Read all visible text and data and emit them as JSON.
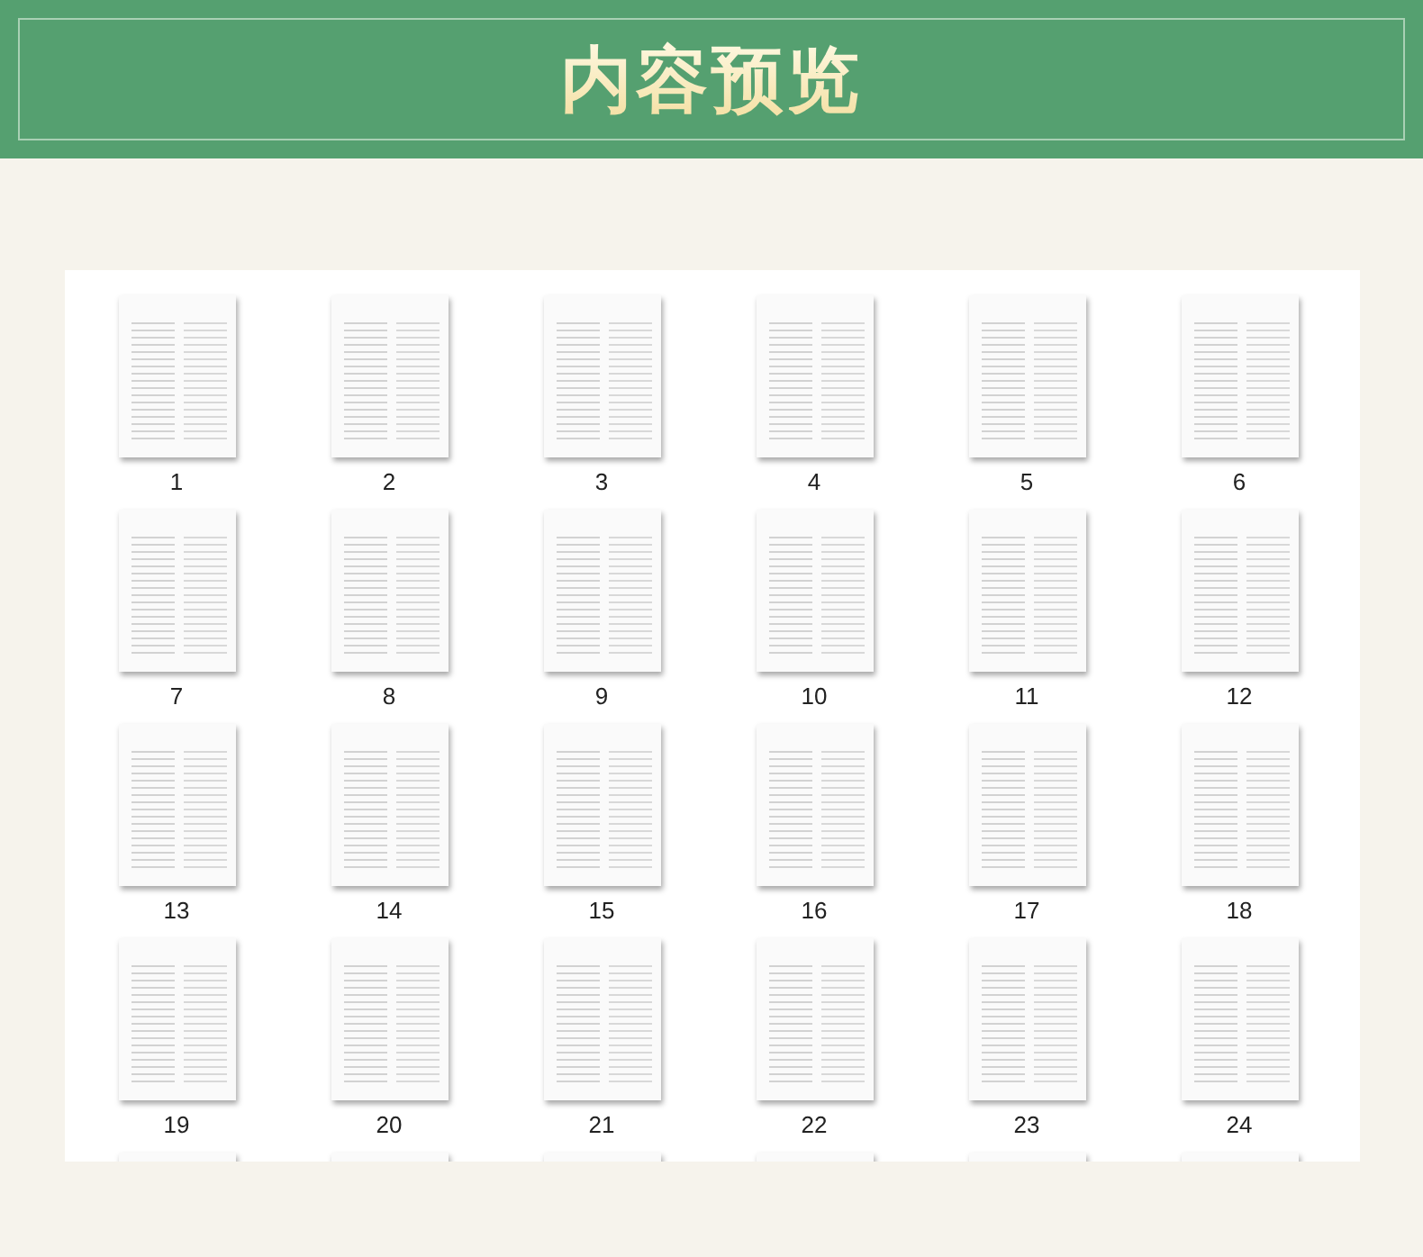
{
  "header": {
    "title": "内容预览"
  },
  "pages": [
    {
      "label": "1"
    },
    {
      "label": "2"
    },
    {
      "label": "3"
    },
    {
      "label": "4"
    },
    {
      "label": "5"
    },
    {
      "label": "6"
    },
    {
      "label": "7"
    },
    {
      "label": "8"
    },
    {
      "label": "9"
    },
    {
      "label": "10"
    },
    {
      "label": "11"
    },
    {
      "label": "12"
    },
    {
      "label": "13"
    },
    {
      "label": "14"
    },
    {
      "label": "15"
    },
    {
      "label": "16"
    },
    {
      "label": "17"
    },
    {
      "label": "18"
    },
    {
      "label": "19"
    },
    {
      "label": "20"
    },
    {
      "label": "21"
    },
    {
      "label": "22"
    },
    {
      "label": "23"
    },
    {
      "label": "24"
    }
  ]
}
